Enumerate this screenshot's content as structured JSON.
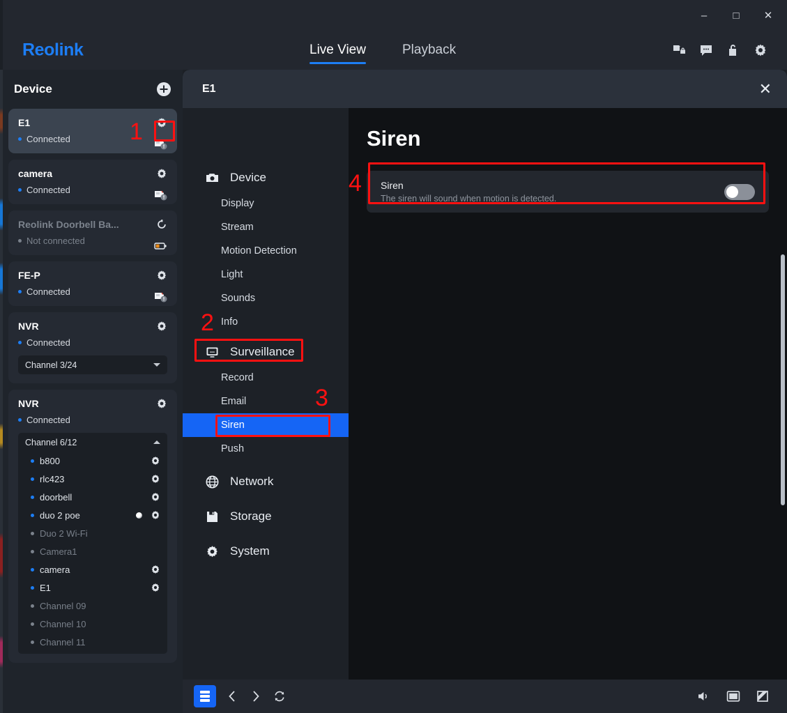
{
  "window": {
    "minimize": "–",
    "maximize": "□",
    "close": "✕"
  },
  "header": {
    "brand": "Reolink",
    "tabs": [
      {
        "label": "Live View",
        "active": true
      },
      {
        "label": "Playback",
        "active": false
      }
    ],
    "icons": [
      "file-lock-icon",
      "chat-icon",
      "unlock-icon",
      "gear-icon"
    ]
  },
  "sidebar": {
    "title": "Device",
    "add_icon": "plus-circle-icon",
    "devices": [
      {
        "name": "E1",
        "status": "Connected",
        "connected": true,
        "selected": true,
        "gear": true,
        "badge": "sd-card-warning-icon"
      },
      {
        "name": "camera",
        "status": "Connected",
        "connected": true,
        "selected": false,
        "gear": true,
        "badge": "sd-card-warning-icon"
      },
      {
        "name": "Reolink Doorbell Ba...",
        "status": "Not connected",
        "connected": false,
        "selected": false,
        "gear": false,
        "badge": "battery-icon",
        "refresh": true
      },
      {
        "name": "FE-P",
        "status": "Connected",
        "connected": true,
        "selected": false,
        "gear": true,
        "badge": "sd-card-warning-icon"
      },
      {
        "name": "NVR",
        "status": "Connected",
        "connected": true,
        "selected": false,
        "gear": true,
        "channel_select": "Channel 3/24"
      },
      {
        "name": "NVR",
        "status": "Connected",
        "connected": true,
        "selected": false,
        "gear": true,
        "channel_list_header": "Channel 6/12"
      }
    ],
    "channels": [
      {
        "label": "b800",
        "online": true,
        "gear": true,
        "led": false
      },
      {
        "label": "rlc423",
        "online": true,
        "gear": true,
        "led": false
      },
      {
        "label": "doorbell",
        "online": true,
        "gear": true,
        "led": false
      },
      {
        "label": "duo 2 poe",
        "online": true,
        "gear": true,
        "led": true
      },
      {
        "label": "Duo 2 Wi-Fi",
        "online": false,
        "gear": false,
        "led": false
      },
      {
        "label": "Camera1",
        "online": false,
        "gear": false,
        "led": false
      },
      {
        "label": "camera",
        "online": true,
        "gear": true,
        "led": false
      },
      {
        "label": "E1",
        "online": true,
        "gear": true,
        "led": false
      },
      {
        "label": "Channel 09",
        "online": false,
        "gear": false,
        "led": false
      },
      {
        "label": "Channel 10",
        "online": false,
        "gear": false,
        "led": false
      },
      {
        "label": "Channel 11",
        "online": false,
        "gear": false,
        "led": false
      }
    ]
  },
  "modal": {
    "title": "E1",
    "close": "✕",
    "menu": [
      {
        "type": "group",
        "label": "Device",
        "icon": "camera-icon"
      },
      {
        "type": "item",
        "label": "Display"
      },
      {
        "type": "item",
        "label": "Stream"
      },
      {
        "type": "item",
        "label": "Motion Detection"
      },
      {
        "type": "item",
        "label": "Light"
      },
      {
        "type": "item",
        "label": "Sounds"
      },
      {
        "type": "item",
        "label": "Info"
      },
      {
        "type": "group",
        "label": "Surveillance",
        "icon": "monitor-icon"
      },
      {
        "type": "item",
        "label": "Record"
      },
      {
        "type": "item",
        "label": "Email"
      },
      {
        "type": "item",
        "label": "Siren",
        "active": true
      },
      {
        "type": "item",
        "label": "Push"
      },
      {
        "type": "group",
        "label": "Network",
        "icon": "globe-icon"
      },
      {
        "type": "group",
        "label": "Storage",
        "icon": "floppy-icon"
      },
      {
        "type": "group",
        "label": "System",
        "icon": "gear-icon"
      }
    ],
    "content": {
      "title": "Siren",
      "setting": {
        "label": "Siren",
        "description": "The siren will sound when motion is detected.",
        "toggle_on": false
      }
    }
  },
  "bottombar": {
    "left": [
      "layout-grid-icon",
      "prev-icon",
      "next-icon",
      "refresh-icon"
    ],
    "right": [
      "volume-icon",
      "picture-icon",
      "fullscreen-icon"
    ]
  },
  "annotations": [
    {
      "number": "1",
      "target": "device-card-e1-gear"
    },
    {
      "number": "2",
      "target": "menu-group-surveillance"
    },
    {
      "number": "3",
      "target": "menu-item-siren"
    },
    {
      "number": "4",
      "target": "siren-setting-card"
    }
  ],
  "colors": {
    "accent": "#1d7ef5",
    "menu_active": "#1565f5",
    "annotation": "#ff1111",
    "panel_bg": "#1f242b",
    "modal_bg": "#101215"
  }
}
